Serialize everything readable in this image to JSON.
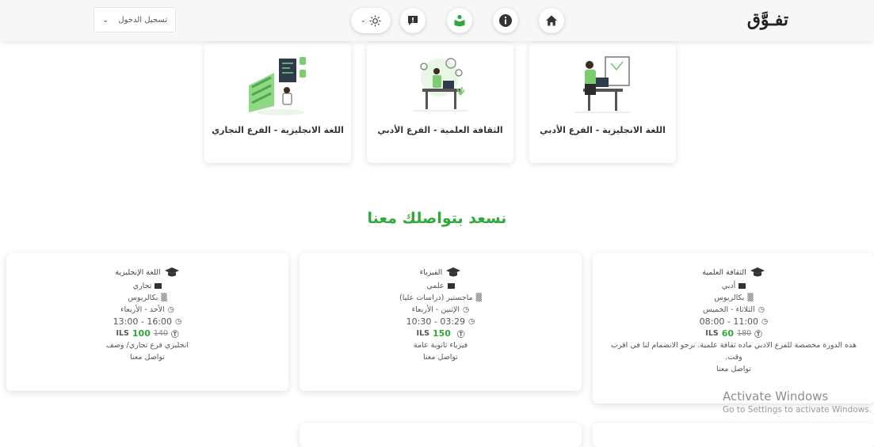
{
  "header": {
    "logo": "تفـوَّق",
    "login_label": "تسجيل الدخول",
    "icons": [
      "home-icon",
      "info-icon",
      "book-reader-icon",
      "feedback-icon",
      "sun-icon"
    ]
  },
  "categories": [
    {
      "title": "اللغة الانجليزية - الفرع الأدبي"
    },
    {
      "title": "الثقافة العلمية - الفرع الأدبي"
    },
    {
      "title": "اللغة الانجليزية - الفرع التجاري"
    }
  ],
  "section_title": "نسعد بتواصلك معنا",
  "courses": [
    {
      "name": "الثقافة العلمية",
      "branch": "أدبي",
      "level": "بكالريوس",
      "days": "الثلاثاء - الخميس",
      "time": "11:00 - 08:00",
      "price": "60",
      "old_price": "180",
      "currency": "ILS",
      "description": "هذه الدورة مخصصة للفرع الادبي ماده ثقافة علمية. نرجو الانضمام لنا في اقرب وقت.",
      "contact": "تواصل معنا"
    },
    {
      "name": "الفيزياء",
      "branch": "علمي",
      "level": "ماجستير (دراسات عليا)",
      "days": "الإثنين - الأربعاء",
      "time": "03:29 - 10:30",
      "price": "150",
      "old_price": "",
      "currency": "ILS",
      "description": "فيزياء ثانوية عامة",
      "contact": "تواصل معنا"
    },
    {
      "name": "اللغة الإنجليزية",
      "branch": "تجاري",
      "level": "بكالريوس",
      "days": "الأحد - الأربعاء",
      "time": "16:00 - 13:00",
      "price": "100",
      "old_price": "140",
      "currency": "ILS",
      "description": "انجليزي فرع تجاري/ وصف",
      "contact": "تواصل معنا"
    }
  ],
  "watermark": {
    "line1": "Activate Windows",
    "line2": "Go to Settings to activate Windows."
  },
  "colors": {
    "accent": "#2eaa3a",
    "topbar": "#f7f7f7"
  }
}
